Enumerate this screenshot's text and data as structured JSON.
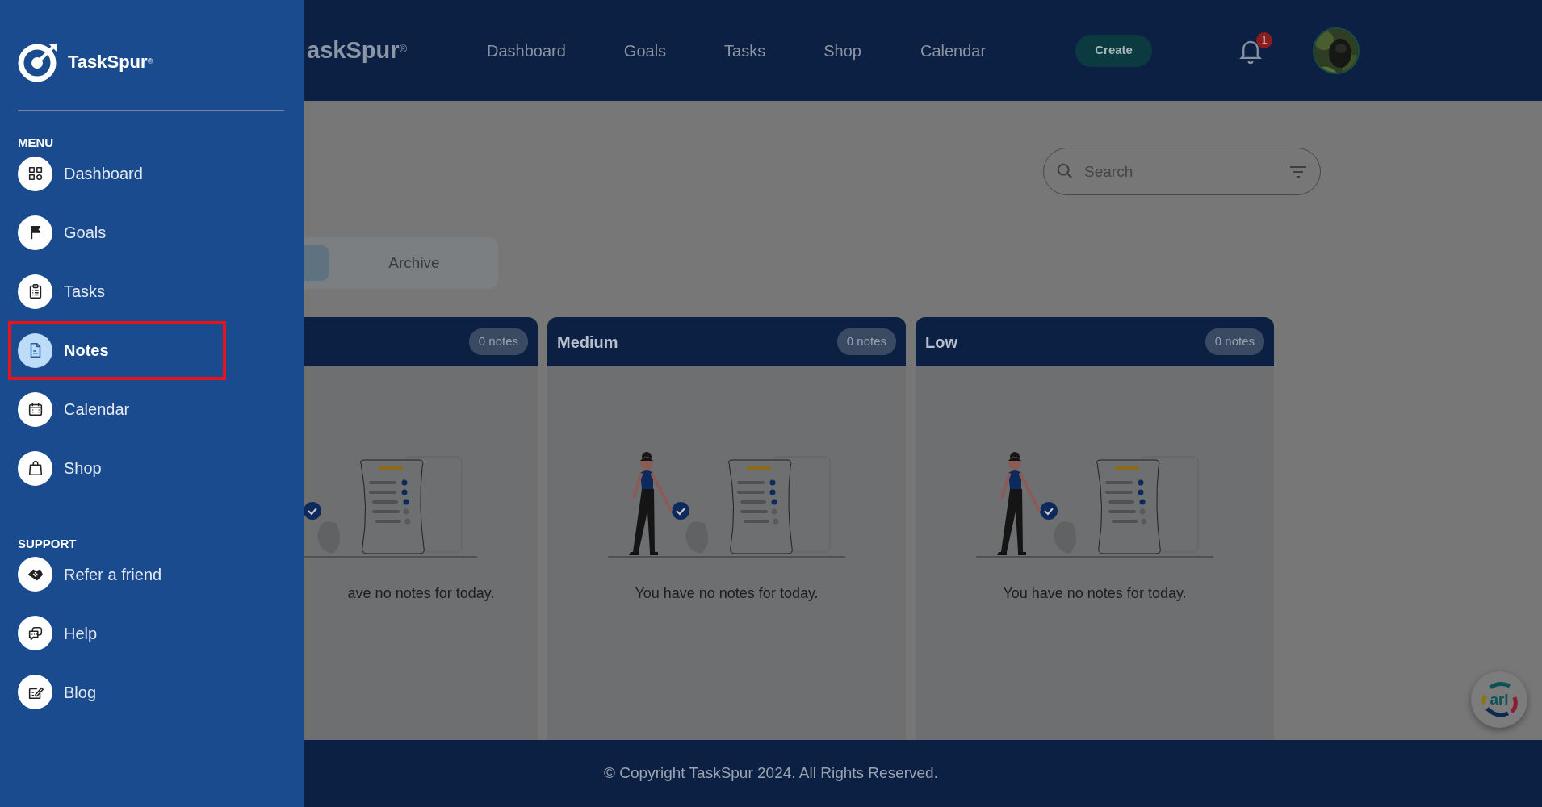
{
  "sidebar": {
    "brand": "TaskSpur$^{®}$",
    "sections": [
      {
        "heading": "MENU",
        "items": [
          {
            "label": "Dashboard",
            "selected": false,
            "highlighted": false
          },
          {
            "label": "Goals",
            "selected": false,
            "highlighted": false
          },
          {
            "label": "Tasks",
            "selected": false,
            "highlighted": false
          },
          {
            "label": "Notes",
            "selected": true,
            "highlighted": true
          },
          {
            "label": "Calendar",
            "selected": false,
            "highlighted": false
          },
          {
            "label": "Shop",
            "selected": false,
            "highlighted": false
          }
        ]
      },
      {
        "heading": "SUPPORT",
        "items": [
          {
            "label": "Refer a friend",
            "selected": false,
            "highlighted": false
          },
          {
            "label": "Help",
            "selected": false,
            "highlighted": false
          },
          {
            "label": "Blog",
            "selected": false,
            "highlighted": false
          }
        ]
      }
    ]
  },
  "header": {
    "brand": "askSpur$^{®}$",
    "nav": [
      "Dashboard",
      "Goals",
      "Tasks",
      "Shop",
      "Calendar"
    ],
    "create_button": "Create",
    "notification_count": "1"
  },
  "search": {
    "placeholder": "Search"
  },
  "tabs": [
    {
      "selected": true
    },
    {
      "label": "Archive",
      "selected": false
    }
  ],
  "columns": [
    {
      "count": "0 notes",
      "empty_text": "ave no notes for today."
    },
    {
      "title": "Medium",
      "count": "0 notes",
      "empty_text": "You have no notes for today."
    },
    {
      "title": "Low",
      "count": "0 notes",
      "empty_text": "You have no notes for today."
    }
  ],
  "footer": "© Copyright TaskSpur 2024. All Rights Reserved.",
  "chat_widget": {
    "label": "ari"
  }
}
